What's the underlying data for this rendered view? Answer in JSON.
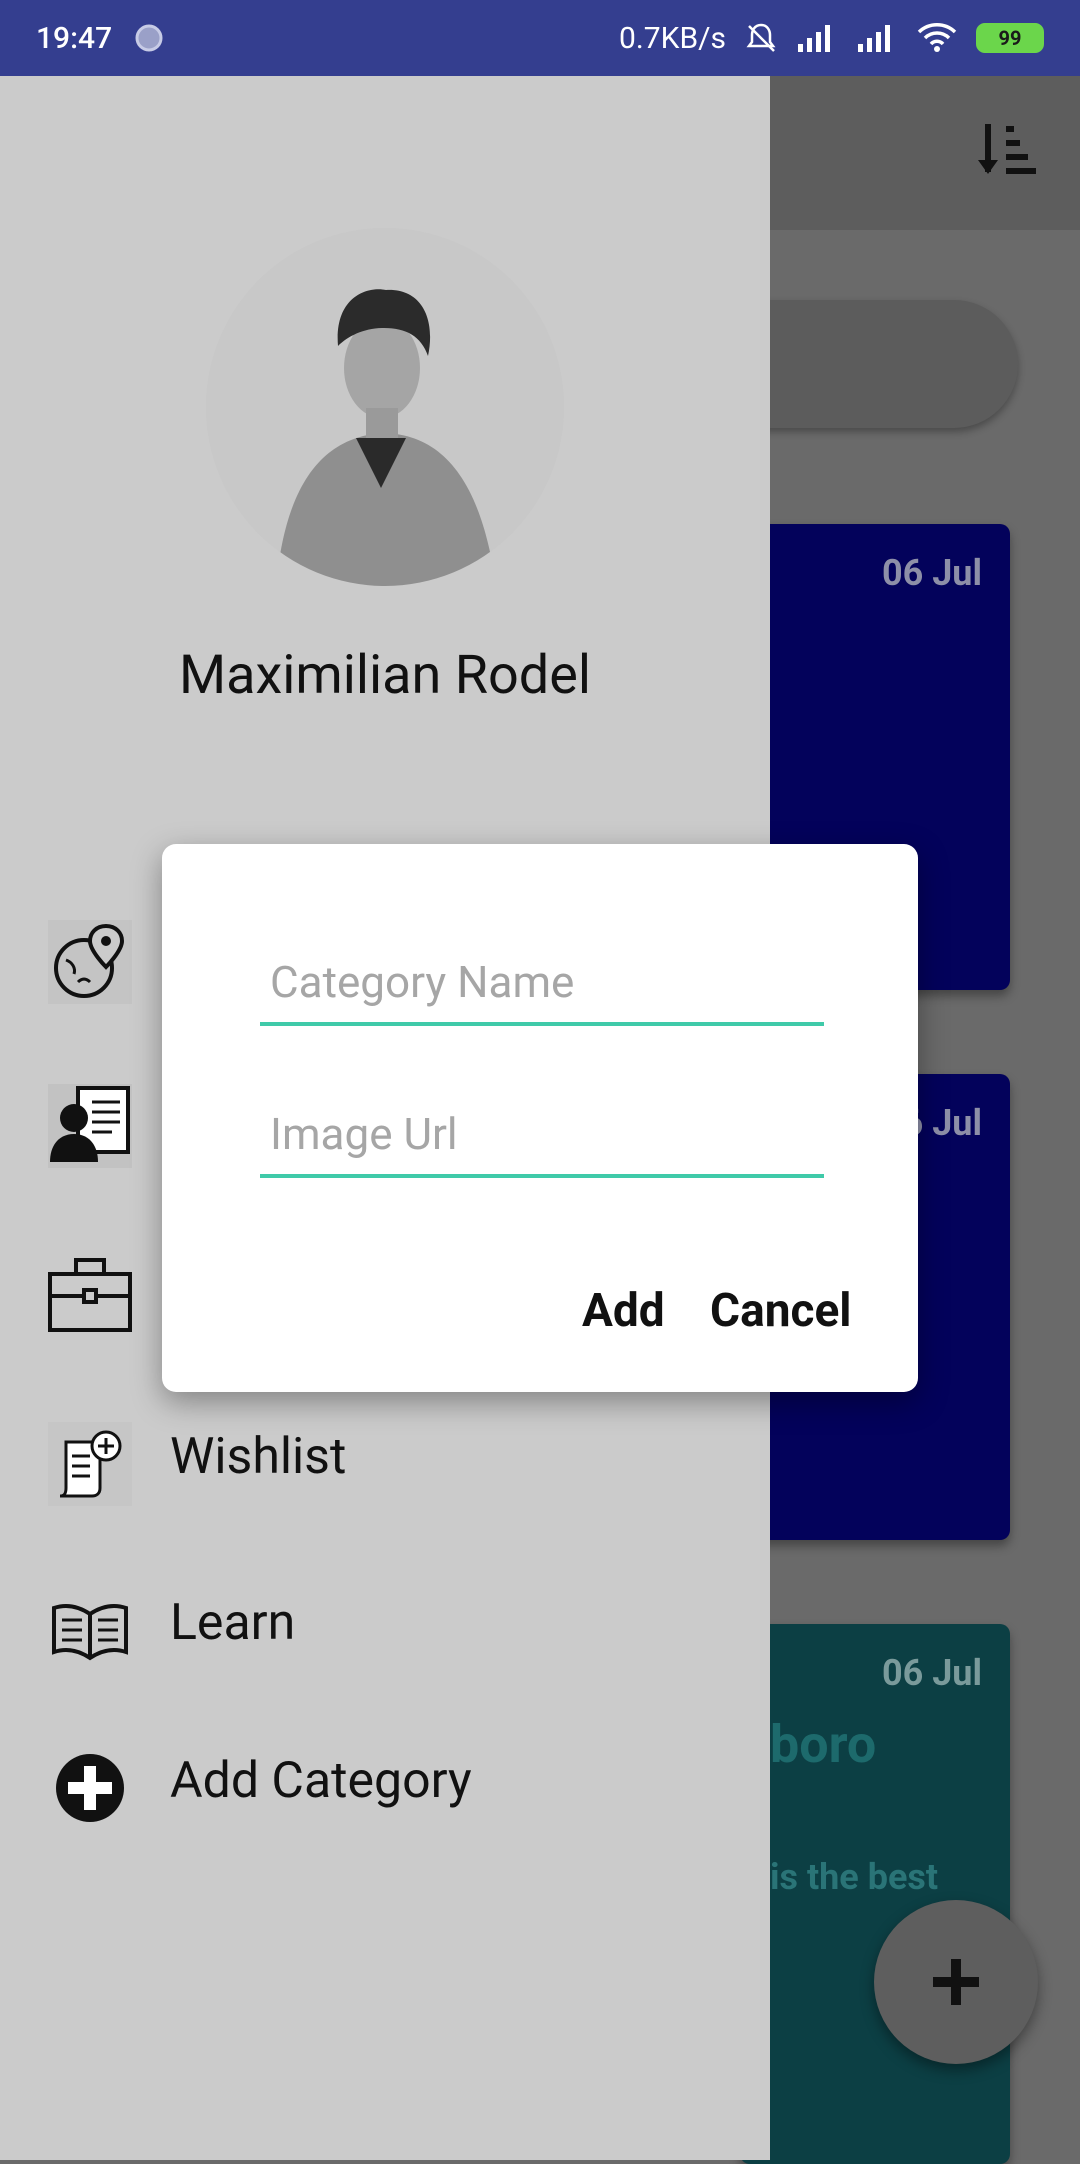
{
  "status_bar": {
    "time": "19:47",
    "net_speed": "0.7KB/s",
    "battery": "99"
  },
  "background": {
    "cards": [
      {
        "date": "06 Jul",
        "color": "#03025b"
      },
      {
        "date": "06 Jul",
        "color": "#03025b",
        "date_partial": "Jul"
      },
      {
        "date": "06 Jul",
        "title": "boro",
        "text": "is the best",
        "color": "#0c3f44"
      }
    ]
  },
  "drawer": {
    "user_name": "Maximilian Rodel",
    "items": [
      {
        "label": "",
        "icon": "travel-globe-icon"
      },
      {
        "label": "",
        "icon": "profile-card-icon"
      },
      {
        "label": "",
        "icon": "briefcase-icon"
      },
      {
        "label": "Wishlist",
        "icon": "wishlist-icon"
      },
      {
        "label": "Learn",
        "icon": "open-book-icon"
      },
      {
        "label": "Add Category",
        "icon": "add-circle-icon"
      }
    ]
  },
  "dialog": {
    "category_placeholder": "Category Name",
    "image_placeholder": "Image Url",
    "add_label": "Add",
    "cancel_label": "Cancel"
  },
  "colors": {
    "status_bar": "#343e8f",
    "accent_underline": "#3fcaa9",
    "drawer_bg": "#cbcbcb"
  }
}
